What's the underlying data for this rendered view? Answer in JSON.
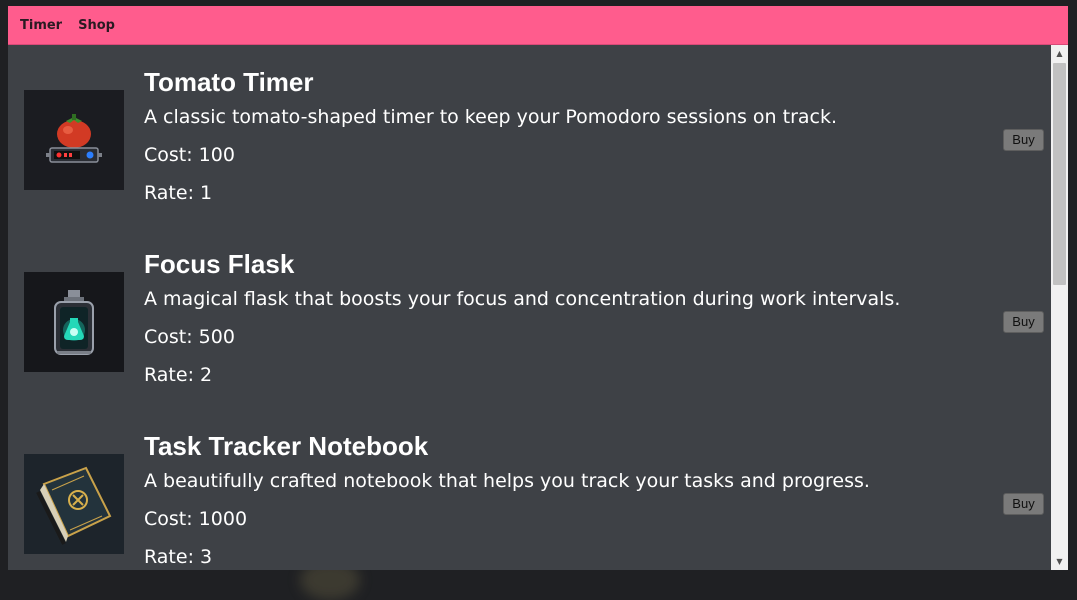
{
  "nav": {
    "links": [
      {
        "label": "Timer"
      },
      {
        "label": "Shop"
      }
    ]
  },
  "items": [
    {
      "title": "Tomato Timer",
      "description": "A classic tomato-shaped timer to keep your Pomodoro sessions on track.",
      "cost": "Cost: 100",
      "rate": "Rate: 1",
      "buy_label": "Buy",
      "image": "tomato-timer-image"
    },
    {
      "title": "Focus Flask",
      "description": "A magical flask that boosts your focus and concentration during work intervals.",
      "cost": "Cost: 500",
      "rate": "Rate: 2",
      "buy_label": "Buy",
      "image": "focus-flask-image"
    },
    {
      "title": "Task Tracker Notebook",
      "description": "A beautifully crafted notebook that helps you track your tasks and progress.",
      "cost": "Cost: 1000",
      "rate": "Rate: 3",
      "buy_label": "Buy",
      "image": "notebook-image"
    }
  ],
  "colors": {
    "nav_bg": "#ff5c8d",
    "panel_bg": "#3e4146",
    "button_bg": "#7a7a7a"
  }
}
